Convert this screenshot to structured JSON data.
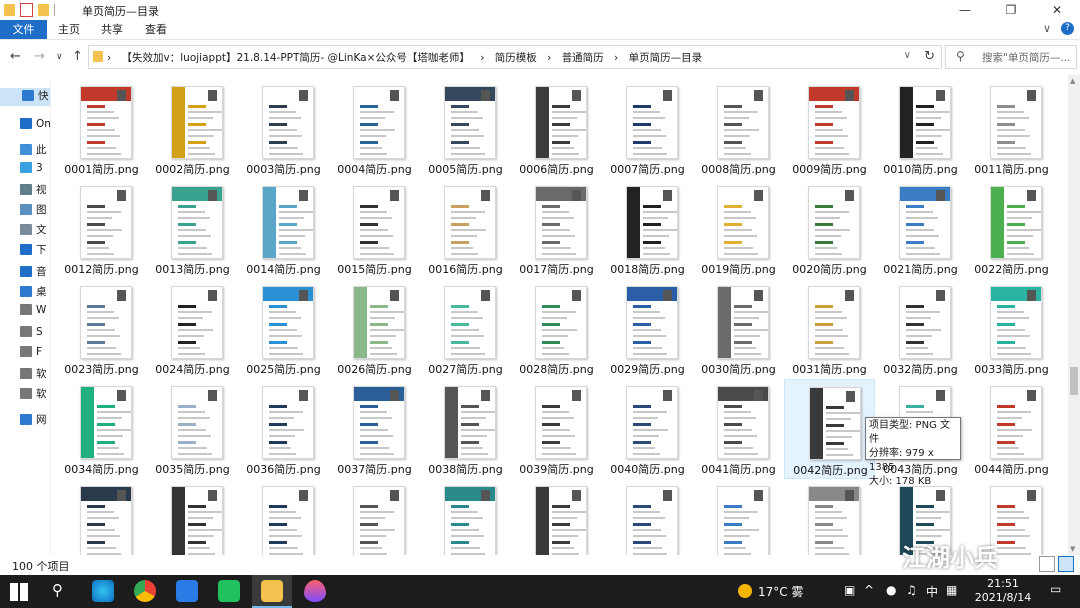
{
  "window": {
    "title": "单页简历—目录",
    "controls": [
      "—",
      "❐",
      "✕"
    ]
  },
  "ribbon": {
    "tabs": [
      "文件",
      "主页",
      "共享",
      "查看"
    ],
    "expand_icon": "∨",
    "help_icon": "?"
  },
  "nav": {
    "back": "←",
    "forward": "→",
    "dropdown": "∨",
    "up": "↑",
    "path": [
      "【失效加v：luojiappt】21.8.14-PPT简历- @LinKa×公众号【塔咖老师】",
      "简历模板",
      "普通简历",
      "单页简历—目录"
    ],
    "path_separator": "›",
    "refresh": "↻",
    "search_placeholder": "搜索\"单页简历—..."
  },
  "sidebar": {
    "items": [
      {
        "label": "快",
        "icon": "star-icon",
        "color": "#2f7ad1"
      },
      {
        "label": "On",
        "icon": "cloud-icon",
        "color": "#1e6ec8"
      },
      {
        "label": "此",
        "icon": "pc-icon",
        "color": "#3f8fd8"
      },
      {
        "label": "3",
        "icon": "cube-icon",
        "color": "#3aa0e0"
      },
      {
        "label": "视",
        "icon": "video-icon",
        "color": "#607d8b"
      },
      {
        "label": "图",
        "icon": "picture-icon",
        "color": "#5a8fc0"
      },
      {
        "label": "文",
        "icon": "document-icon",
        "color": "#7a8a9a"
      },
      {
        "label": "下",
        "icon": "download-icon",
        "color": "#1e6ec8"
      },
      {
        "label": "音",
        "icon": "music-icon",
        "color": "#1e6ec8"
      },
      {
        "label": "桌",
        "icon": "desktop-icon",
        "color": "#2f7ad1"
      },
      {
        "label": "W",
        "icon": "drive-icon",
        "color": "#777"
      },
      {
        "label": "S",
        "icon": "drive-icon",
        "color": "#777"
      },
      {
        "label": "F",
        "icon": "drive-icon",
        "color": "#777"
      },
      {
        "label": "软",
        "icon": "drive-icon",
        "color": "#777"
      },
      {
        "label": "软",
        "icon": "drive-icon",
        "color": "#777"
      },
      {
        "label": "网",
        "icon": "network-icon",
        "color": "#2f7ad1"
      }
    ]
  },
  "files": [
    {
      "name": "0001简历.png",
      "accent": "#c0392b"
    },
    {
      "name": "0002简历.png",
      "accent": "#d4a017"
    },
    {
      "name": "0003简历.png",
      "accent": "#2c3e50"
    },
    {
      "name": "0004简历.png",
      "accent": "#2a6496"
    },
    {
      "name": "0005简历.png",
      "accent": "#34495e"
    },
    {
      "name": "0006简历.png",
      "accent": "#3b3b3b"
    },
    {
      "name": "0007简历.png",
      "accent": "#1f3a6b"
    },
    {
      "name": "0008简历.png",
      "accent": "#555555"
    },
    {
      "name": "0009简历.png",
      "accent": "#c0392b"
    },
    {
      "name": "0010简历.png",
      "accent": "#222222"
    },
    {
      "name": "0011简历.png",
      "accent": "#8e8e8e"
    },
    {
      "name": "0012简历.png",
      "accent": "#4a4a4a"
    },
    {
      "name": "0013简历.png",
      "accent": "#3aa38f"
    },
    {
      "name": "0014简历.png",
      "accent": "#5aa6c8"
    },
    {
      "name": "0015简历.png",
      "accent": "#333333"
    },
    {
      "name": "0016简历.png",
      "accent": "#c8a060"
    },
    {
      "name": "0017简历.png",
      "accent": "#6a6a6a"
    },
    {
      "name": "0018简历.png",
      "accent": "#222222"
    },
    {
      "name": "0019简历.png",
      "accent": "#e0b030"
    },
    {
      "name": "0020简历.png",
      "accent": "#3a7a3a"
    },
    {
      "name": "0021简历.png",
      "accent": "#3b7dc4"
    },
    {
      "name": "0022简历.png",
      "accent": "#4caf50"
    },
    {
      "name": "0023简历.png",
      "accent": "#5a7a9a"
    },
    {
      "name": "0024简历.png",
      "accent": "#222222"
    },
    {
      "name": "0025简历.png",
      "accent": "#2a8fd4"
    },
    {
      "name": "0026简历.png",
      "accent": "#8ab88a"
    },
    {
      "name": "0027简历.png",
      "accent": "#4ab89a"
    },
    {
      "name": "0028简历.png",
      "accent": "#2e8b57"
    },
    {
      "name": "0029简历.png",
      "accent": "#2a5fa8"
    },
    {
      "name": "0030简历.png",
      "accent": "#6b6b6b"
    },
    {
      "name": "0031简历.png",
      "accent": "#c8a040"
    },
    {
      "name": "0032简历.png",
      "accent": "#333333"
    },
    {
      "name": "0033简历.png",
      "accent": "#2ab3a0"
    },
    {
      "name": "0034简历.png",
      "accent": "#20b080"
    },
    {
      "name": "0035简历.png",
      "accent": "#9ab0c8"
    },
    {
      "name": "0036简历.png",
      "accent": "#1f3a5a"
    },
    {
      "name": "0037简历.png",
      "accent": "#2a5f9a"
    },
    {
      "name": "0038简历.png",
      "accent": "#555555"
    },
    {
      "name": "0039简历.png",
      "accent": "#3a3a3a"
    },
    {
      "name": "0040简历.png",
      "accent": "#2a4a7a"
    },
    {
      "name": "0041简历.png",
      "accent": "#4a4a4a"
    },
    {
      "name": "0042简历.png",
      "accent": "#3a3a3a"
    },
    {
      "name": "0043简历.png",
      "accent": "#3ab0a0"
    },
    {
      "name": "0044简历.png",
      "accent": "#c0392b"
    },
    {
      "name": "",
      "accent": "#2a3a4a"
    },
    {
      "name": "",
      "accent": "#333333"
    },
    {
      "name": "",
      "accent": "#1f3a5a"
    },
    {
      "name": "",
      "accent": "#555555"
    },
    {
      "name": "",
      "accent": "#2a8a8a"
    },
    {
      "name": "",
      "accent": "#3a3a3a"
    },
    {
      "name": "",
      "accent": "#2a4a7a"
    },
    {
      "name": "",
      "accent": "#3b7dc4"
    },
    {
      "name": "",
      "accent": "#888888"
    },
    {
      "name": "",
      "accent": "#1f4a5a"
    },
    {
      "name": "",
      "accent": "#c0392b"
    }
  ],
  "tooltip": {
    "line1": "项目类型: PNG 文件",
    "line2": "分辨率: 979 x 1385",
    "line3": "大小: 178 KB"
  },
  "status": {
    "item_count": "100 个项目",
    "watermark": "江湖小兵"
  },
  "taskbar": {
    "weather": "17°C 雾",
    "ime": "中",
    "time": "21:51",
    "date": "2021/8/14",
    "notify": "▭"
  }
}
